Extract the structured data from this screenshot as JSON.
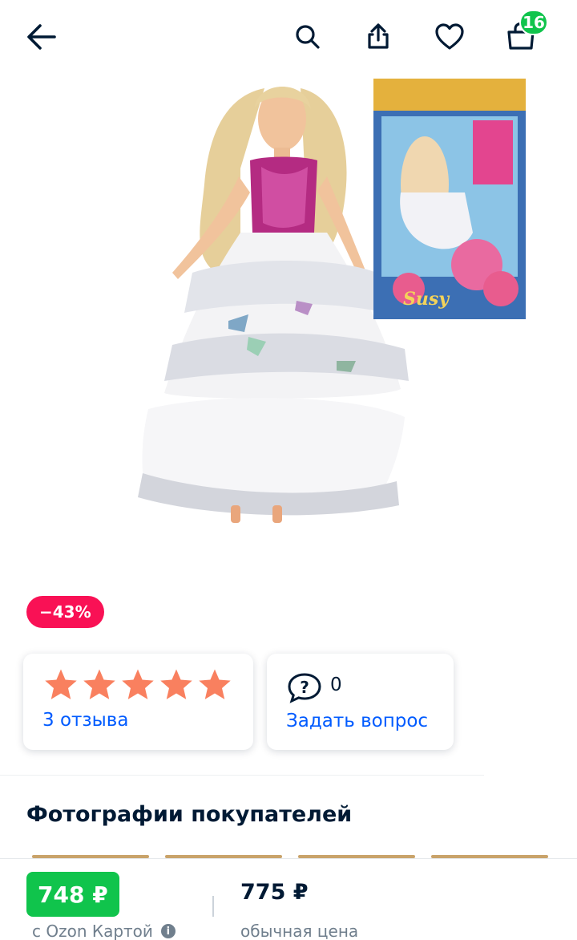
{
  "header": {
    "cart_count": "16",
    "icons": [
      "arrow-left-icon",
      "search-icon",
      "share-icon",
      "heart-icon",
      "shopping-bag-icon"
    ]
  },
  "product": {
    "discount": "−43%",
    "box_text": "Susy"
  },
  "rating": {
    "stars_filled": 5,
    "stars_total": 5,
    "star_color": "#f9805f",
    "reviews_label": "3 отзыва"
  },
  "questions": {
    "count": "0",
    "ask_label": "Задать вопрос"
  },
  "customer_photos": {
    "title": "Фотографии покупателей"
  },
  "pricing": {
    "card_price": "748 ₽",
    "card_label": "с Ozon Картой",
    "regular_price": "775 ₽",
    "regular_label": "обычная цена"
  },
  "colors": {
    "accent_blue": "#005bff",
    "discount_red": "#f91155",
    "ozon_green": "#10c44c",
    "text_dark": "#001a34",
    "text_grey": "#707f8d"
  }
}
